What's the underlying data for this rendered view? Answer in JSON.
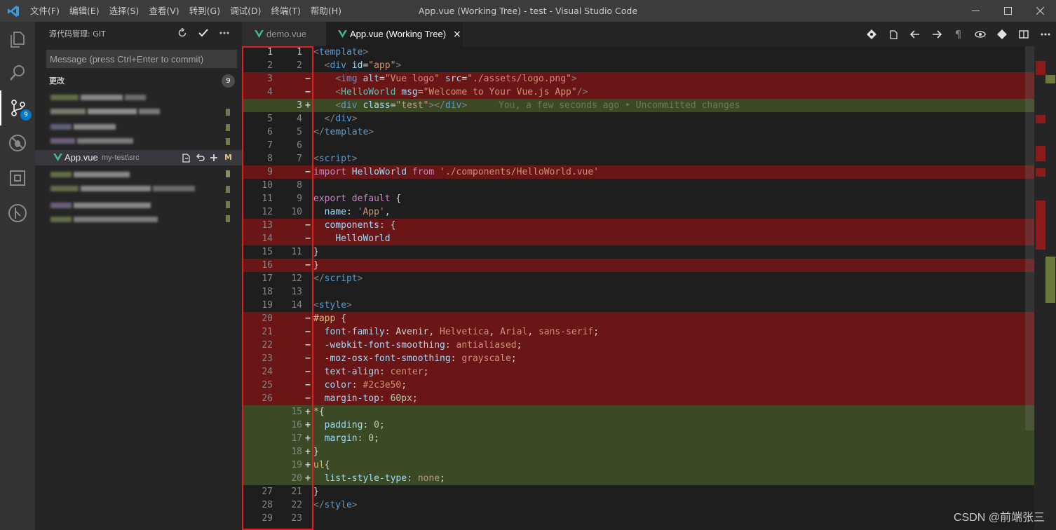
{
  "window": {
    "title": "App.vue (Working Tree) - test - Visual Studio Code",
    "menu": [
      "文件(F)",
      "编辑(E)",
      "选择(S)",
      "查看(V)",
      "转到(G)",
      "调试(D)",
      "终端(T)",
      "帮助(H)"
    ]
  },
  "activity": {
    "scm_badge": "9"
  },
  "sidebar": {
    "title": "源代码管理: GIT",
    "commit_placeholder": "Message (press Ctrl+Enter to commit)",
    "changes_label": "更改",
    "changes_count": "9",
    "selected_file": {
      "name": "App.vue",
      "path": "my-test\\src",
      "status": "M"
    }
  },
  "tabs": [
    {
      "label": "demo.vue",
      "active": false
    },
    {
      "label": "App.vue (Working Tree)",
      "active": true,
      "close": "×"
    }
  ],
  "editor": {
    "blame": "You, a few seconds ago • Uncommitted changes",
    "lines": [
      {
        "old": "1",
        "new": "1",
        "type": "ctx",
        "active": true
      },
      {
        "old": "2",
        "new": "2",
        "type": "ctx"
      },
      {
        "old": "3",
        "new": "",
        "type": "del"
      },
      {
        "old": "4",
        "new": "",
        "type": "del"
      },
      {
        "old": "",
        "new": "3",
        "type": "ins",
        "active": true
      },
      {
        "old": "5",
        "new": "4",
        "type": "ctx"
      },
      {
        "old": "6",
        "new": "5",
        "type": "ctx"
      },
      {
        "old": "7",
        "new": "6",
        "type": "ctx"
      },
      {
        "old": "8",
        "new": "7",
        "type": "ctx"
      },
      {
        "old": "9",
        "new": "",
        "type": "del"
      },
      {
        "old": "10",
        "new": "8",
        "type": "ctx"
      },
      {
        "old": "11",
        "new": "9",
        "type": "ctx"
      },
      {
        "old": "12",
        "new": "10",
        "type": "ctx"
      },
      {
        "old": "13",
        "new": "",
        "type": "del"
      },
      {
        "old": "14",
        "new": "",
        "type": "del"
      },
      {
        "old": "15",
        "new": "11",
        "type": "ctx"
      },
      {
        "old": "16",
        "new": "",
        "type": "del"
      },
      {
        "old": "17",
        "new": "12",
        "type": "ctx"
      },
      {
        "old": "18",
        "new": "13",
        "type": "ctx"
      },
      {
        "old": "19",
        "new": "14",
        "type": "ctx"
      },
      {
        "old": "20",
        "new": "",
        "type": "del"
      },
      {
        "old": "21",
        "new": "",
        "type": "del"
      },
      {
        "old": "22",
        "new": "",
        "type": "del"
      },
      {
        "old": "23",
        "new": "",
        "type": "del"
      },
      {
        "old": "24",
        "new": "",
        "type": "del"
      },
      {
        "old": "25",
        "new": "",
        "type": "del"
      },
      {
        "old": "26",
        "new": "",
        "type": "del"
      },
      {
        "old": "",
        "new": "15",
        "type": "ins"
      },
      {
        "old": "",
        "new": "16",
        "type": "ins"
      },
      {
        "old": "",
        "new": "17",
        "type": "ins"
      },
      {
        "old": "",
        "new": "18",
        "type": "ins"
      },
      {
        "old": "",
        "new": "19",
        "type": "ins"
      },
      {
        "old": "",
        "new": "20",
        "type": "ins"
      },
      {
        "old": "27",
        "new": "21",
        "type": "ctx"
      },
      {
        "old": "28",
        "new": "22",
        "type": "ctx"
      },
      {
        "old": "29",
        "new": "23",
        "type": "ctx"
      }
    ],
    "code": [
      [
        [
          "tk-br",
          "<"
        ],
        [
          "tk-tag",
          "template"
        ],
        [
          "tk-br",
          ">"
        ]
      ],
      [
        [
          "tk-txt",
          "  "
        ],
        [
          "tk-br",
          "<"
        ],
        [
          "tk-tag",
          "div"
        ],
        [
          "tk-txt",
          " "
        ],
        [
          "tk-attr",
          "id"
        ],
        [
          "tk-txt",
          "="
        ],
        [
          "tk-str",
          "\"app\""
        ],
        [
          "tk-br",
          ">"
        ]
      ],
      [
        [
          "tk-txt",
          "    "
        ],
        [
          "tk-br",
          "<"
        ],
        [
          "tk-tag",
          "img"
        ],
        [
          "tk-txt",
          " "
        ],
        [
          "tk-attr",
          "alt"
        ],
        [
          "tk-txt",
          "="
        ],
        [
          "tk-str",
          "\"Vue logo\""
        ],
        [
          "tk-txt",
          " "
        ],
        [
          "tk-attr",
          "src"
        ],
        [
          "tk-txt",
          "="
        ],
        [
          "tk-str",
          "\"./assets/logo.png\""
        ],
        [
          "tk-br",
          ">"
        ]
      ],
      [
        [
          "tk-txt",
          "    "
        ],
        [
          "tk-br",
          "<"
        ],
        [
          "tk-cls",
          "HelloWorld"
        ],
        [
          "tk-txt",
          " "
        ],
        [
          "tk-attr",
          "msg"
        ],
        [
          "tk-txt",
          "="
        ],
        [
          "tk-str",
          "\"Welcome to Your Vue.js App\""
        ],
        [
          "tk-br",
          "/>"
        ]
      ],
      [
        [
          "tk-txt",
          "    "
        ],
        [
          "tk-br",
          "<"
        ],
        [
          "tk-tag",
          "div"
        ],
        [
          "tk-txt",
          " "
        ],
        [
          "tk-attr",
          "class"
        ],
        [
          "tk-txt",
          "="
        ],
        [
          "tk-str",
          "\"test\""
        ],
        [
          "tk-br",
          "></"
        ],
        [
          "tk-tag",
          "div"
        ],
        [
          "tk-br",
          ">"
        ]
      ],
      [
        [
          "tk-txt",
          "  "
        ],
        [
          "tk-br",
          "</"
        ],
        [
          "tk-tag",
          "div"
        ],
        [
          "tk-br",
          ">"
        ]
      ],
      [
        [
          "tk-br",
          "</"
        ],
        [
          "tk-tag",
          "template"
        ],
        [
          "tk-br",
          ">"
        ]
      ],
      [],
      [
        [
          "tk-br",
          "<"
        ],
        [
          "tk-tag",
          "script"
        ],
        [
          "tk-br",
          ">"
        ]
      ],
      [
        [
          "tk-kw",
          "import"
        ],
        [
          "tk-txt",
          " "
        ],
        [
          "tk-id",
          "HelloWorld"
        ],
        [
          "tk-txt",
          " "
        ],
        [
          "tk-kw",
          "from"
        ],
        [
          "tk-txt",
          " "
        ],
        [
          "tk-str",
          "'./components/HelloWorld.vue'"
        ]
      ],
      [],
      [
        [
          "tk-kw",
          "export"
        ],
        [
          "tk-txt",
          " "
        ],
        [
          "tk-kw",
          "default"
        ],
        [
          "tk-txt",
          " {"
        ]
      ],
      [
        [
          "tk-txt",
          "  "
        ],
        [
          "tk-id",
          "name"
        ],
        [
          "tk-txt",
          ": "
        ],
        [
          "tk-str",
          "'App'"
        ],
        [
          "tk-txt",
          ","
        ]
      ],
      [
        [
          "tk-txt",
          "  "
        ],
        [
          "tk-id",
          "components"
        ],
        [
          "tk-txt",
          ": {"
        ]
      ],
      [
        [
          "tk-txt",
          "    "
        ],
        [
          "tk-id",
          "HelloWorld"
        ]
      ],
      [
        [
          "tk-txt",
          "}"
        ]
      ],
      [
        [
          "tk-txt",
          "}"
        ]
      ],
      [
        [
          "tk-br",
          "</"
        ],
        [
          "tk-tag",
          "script"
        ],
        [
          "tk-br",
          ">"
        ]
      ],
      [],
      [
        [
          "tk-br",
          "<"
        ],
        [
          "tk-tag",
          "style"
        ],
        [
          "tk-br",
          ">"
        ]
      ],
      [
        [
          "tk-sel",
          "#app"
        ],
        [
          "tk-txt",
          " {"
        ]
      ],
      [
        [
          "tk-txt",
          "  "
        ],
        [
          "tk-attr",
          "font-family"
        ],
        [
          "tk-txt",
          ": Avenir, "
        ],
        [
          "tk-str",
          "Helvetica"
        ],
        [
          "tk-txt",
          ", "
        ],
        [
          "tk-str",
          "Arial"
        ],
        [
          "tk-txt",
          ", "
        ],
        [
          "tk-str",
          "sans-serif"
        ],
        [
          "tk-txt",
          ";"
        ]
      ],
      [
        [
          "tk-txt",
          "  "
        ],
        [
          "tk-attr",
          "-webkit-font-smoothing"
        ],
        [
          "tk-txt",
          ": "
        ],
        [
          "tk-str",
          "antialiased"
        ],
        [
          "tk-txt",
          ";"
        ]
      ],
      [
        [
          "tk-txt",
          "  "
        ],
        [
          "tk-attr",
          "-moz-osx-font-smoothing"
        ],
        [
          "tk-txt",
          ": "
        ],
        [
          "tk-str",
          "grayscale"
        ],
        [
          "tk-txt",
          ";"
        ]
      ],
      [
        [
          "tk-txt",
          "  "
        ],
        [
          "tk-attr",
          "text-align"
        ],
        [
          "tk-txt",
          ": "
        ],
        [
          "tk-str",
          "center"
        ],
        [
          "tk-txt",
          ";"
        ]
      ],
      [
        [
          "tk-txt",
          "  "
        ],
        [
          "tk-attr",
          "color"
        ],
        [
          "tk-txt",
          ": "
        ],
        [
          "tk-str",
          "#2c3e50"
        ],
        [
          "tk-txt",
          ";"
        ]
      ],
      [
        [
          "tk-txt",
          "  "
        ],
        [
          "tk-attr",
          "margin-top"
        ],
        [
          "tk-txt",
          ": "
        ],
        [
          "tk-num",
          "60px"
        ],
        [
          "tk-txt",
          ";"
        ]
      ],
      [
        [
          "tk-sel",
          "*"
        ],
        [
          "tk-txt",
          "{"
        ]
      ],
      [
        [
          "tk-txt",
          "  "
        ],
        [
          "tk-attr",
          "padding"
        ],
        [
          "tk-txt",
          ": "
        ],
        [
          "tk-num",
          "0"
        ],
        [
          "tk-txt",
          ";"
        ]
      ],
      [
        [
          "tk-txt",
          "  "
        ],
        [
          "tk-attr",
          "margin"
        ],
        [
          "tk-txt",
          ": "
        ],
        [
          "tk-num",
          "0"
        ],
        [
          "tk-txt",
          ";"
        ]
      ],
      [
        [
          "tk-txt",
          "}"
        ]
      ],
      [
        [
          "tk-sel",
          "ul"
        ],
        [
          "tk-txt",
          "{"
        ]
      ],
      [
        [
          "tk-txt",
          "  "
        ],
        [
          "tk-attr",
          "list-style-type"
        ],
        [
          "tk-txt",
          ": "
        ],
        [
          "tk-str",
          "none"
        ],
        [
          "tk-txt",
          ";"
        ]
      ],
      [
        [
          "tk-txt",
          "}"
        ]
      ],
      [
        [
          "tk-br",
          "</"
        ],
        [
          "tk-tag",
          "style"
        ],
        [
          "tk-br",
          ">"
        ]
      ],
      []
    ]
  },
  "watermark": "CSDN @前端张三",
  "colors": {
    "deleted_bg": "#6b1616",
    "inserted_bg": "#3b4a24",
    "gutter_box": "#e02020",
    "accent": "#007acc",
    "vue_green": "#41b883"
  }
}
